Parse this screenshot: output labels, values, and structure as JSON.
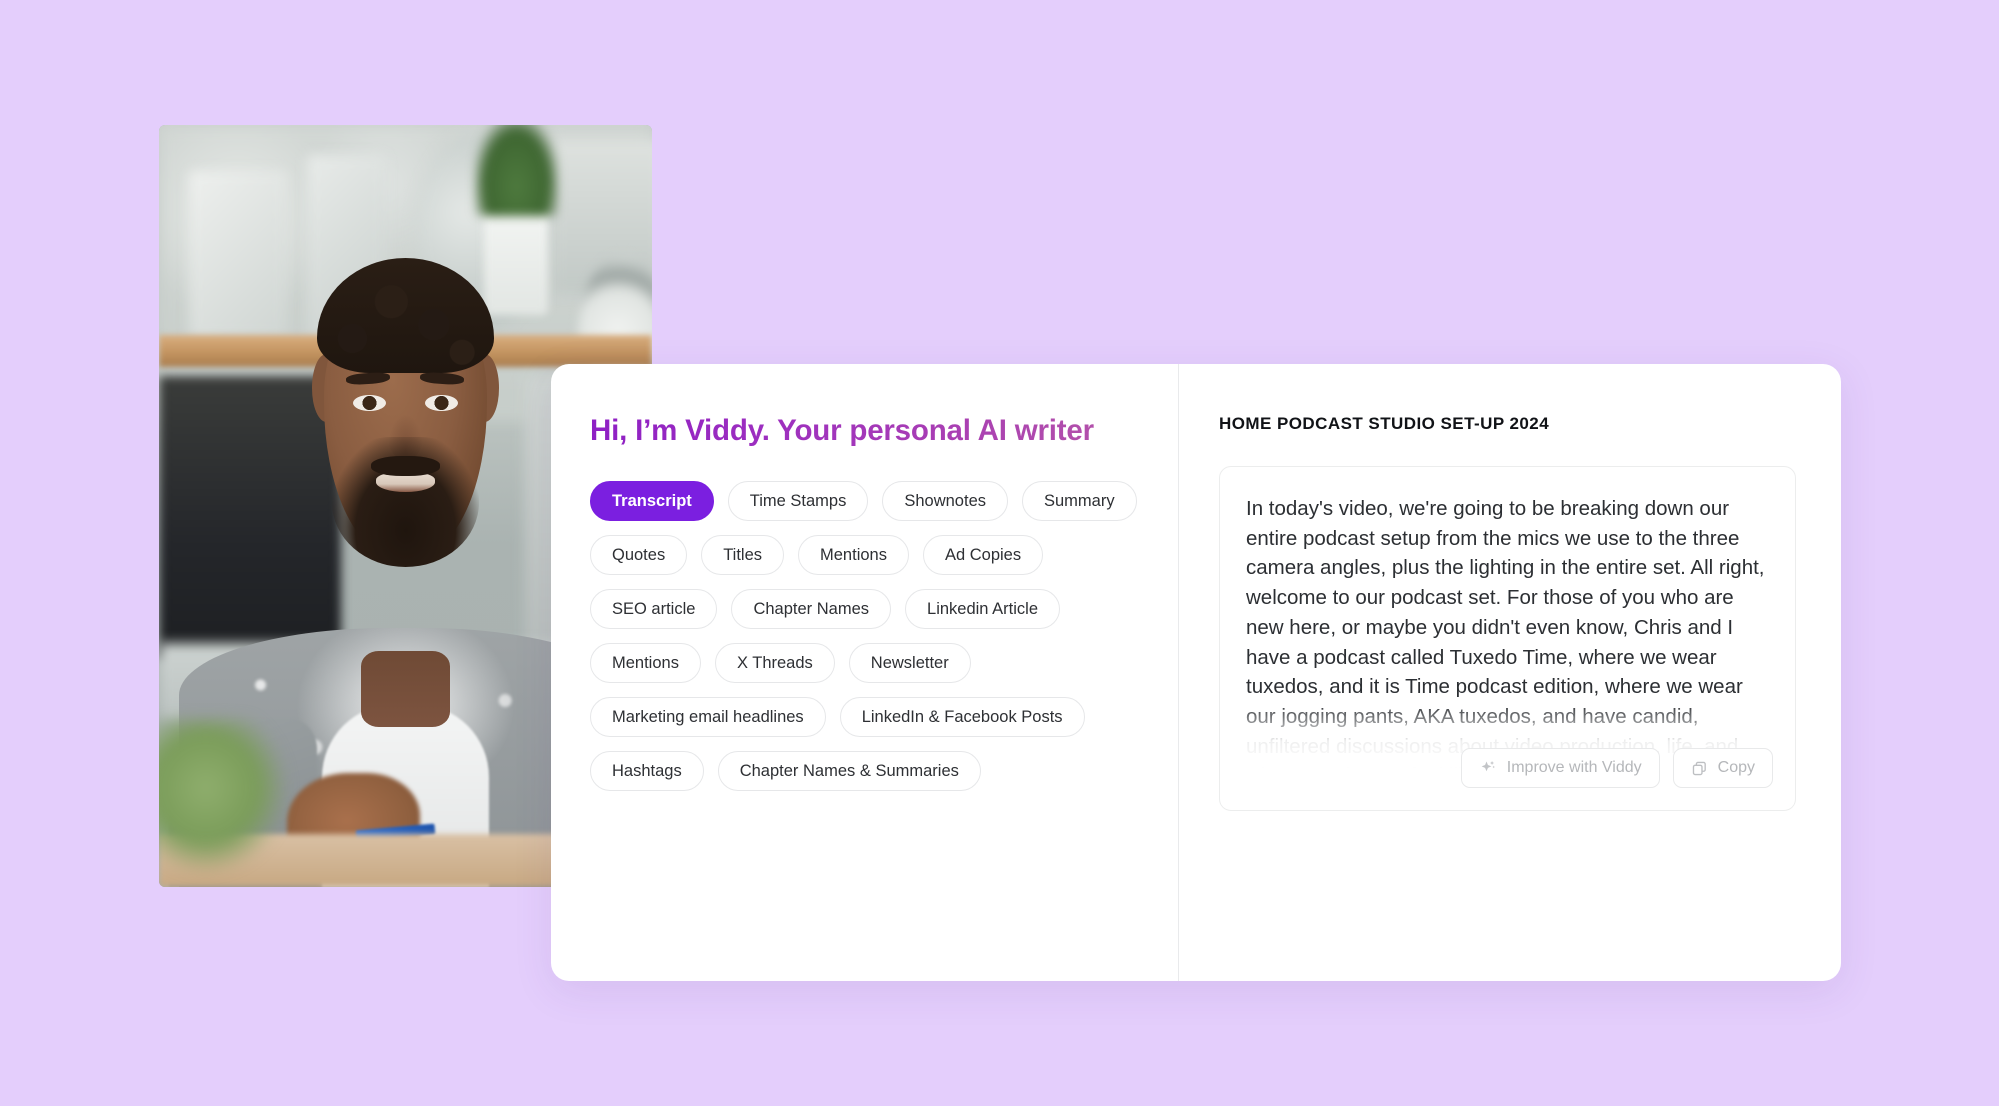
{
  "background_color": "#e4cefc",
  "photo": {
    "alt": "man-speaking-to-camera-in-home-podcast-studio"
  },
  "left_pane": {
    "hero_title": "Hi, I’m Viddy. Your personal AI writer",
    "accent_color": "#7b1fe0",
    "chips": [
      {
        "label": "Transcript",
        "active": true
      },
      {
        "label": "Time Stamps",
        "active": false
      },
      {
        "label": "Shownotes",
        "active": false
      },
      {
        "label": "Summary",
        "active": false
      },
      {
        "label": "Quotes",
        "active": false
      },
      {
        "label": "Titles",
        "active": false
      },
      {
        "label": "Mentions",
        "active": false
      },
      {
        "label": "Ad Copies",
        "active": false
      },
      {
        "label": "SEO article",
        "active": false
      },
      {
        "label": "Chapter Names",
        "active": false
      },
      {
        "label": "Linkedin Article",
        "active": false
      },
      {
        "label": "Mentions",
        "active": false
      },
      {
        "label": "X Threads",
        "active": false
      },
      {
        "label": "Newsletter",
        "active": false
      },
      {
        "label": "Marketing email headlines",
        "active": false
      },
      {
        "label": "LinkedIn & Facebook Posts",
        "active": false
      },
      {
        "label": "Hashtags",
        "active": false
      },
      {
        "label": "Chapter Names & Summaries",
        "active": false
      }
    ]
  },
  "right_pane": {
    "document_title": "HOME PODCAST STUDIO SET-UP 2024",
    "transcript": "In today's video, we're going to be breaking down our entire podcast setup from the mics we use to the three camera angles, plus the lighting in the entire set. All right, welcome to our podcast set. For those of you who are new here, or maybe you didn't even know, Chris and I have a podcast called Tuxedo Time, where we wear tuxedos, and it is Time podcast edition, where we wear our jogging pants, AKA tuxedos, and have candid, unfiltered discussions about video production, life, and whatever else we feel like talking about.",
    "actions": [
      {
        "label": "Improve with Viddy",
        "icon": "sparkle-icon"
      },
      {
        "label": "Copy",
        "icon": "copy-icon"
      }
    ]
  }
}
